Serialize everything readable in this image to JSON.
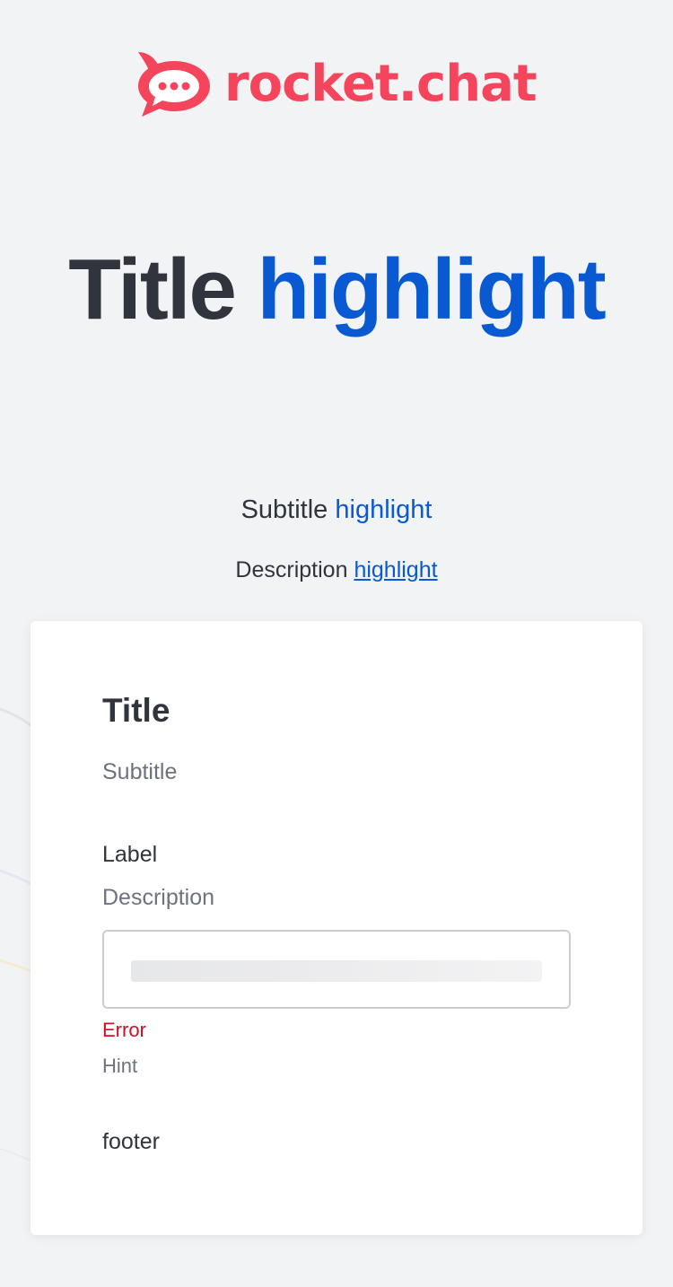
{
  "brand": {
    "name": "rocket.chat",
    "color": "#f5455c",
    "icon": "rocket-chat-logo-icon"
  },
  "hero": {
    "title": "Title",
    "title_highlight": "highlight",
    "subtitle": "Subtitle",
    "subtitle_highlight": "highlight",
    "description": "Description",
    "description_link": "highlight",
    "highlight_color": "#095ad2"
  },
  "card": {
    "title": "Title",
    "subtitle": "Subtitle",
    "field": {
      "label": "Label",
      "description": "Description",
      "value": "",
      "error": "Error",
      "hint": "Hint"
    },
    "footer": "footer"
  },
  "colors": {
    "background": "#f2f3f5",
    "text": "#2f343d",
    "muted": "#6c737f",
    "error": "#d40c26"
  }
}
